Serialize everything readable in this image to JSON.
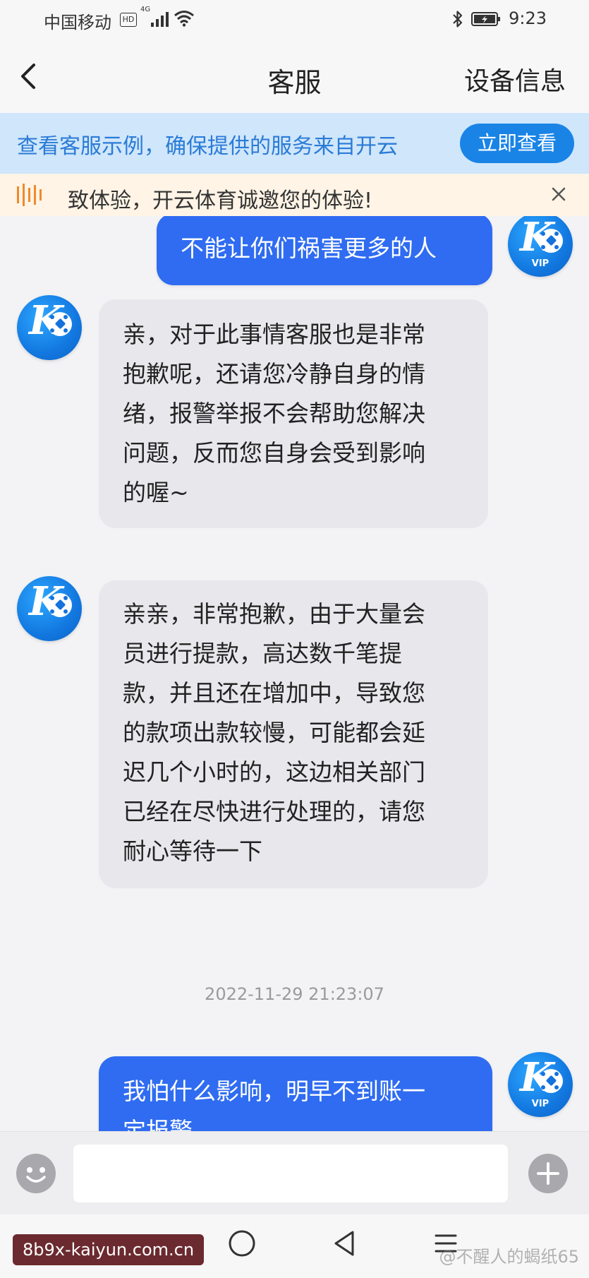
{
  "status_bar": {
    "carrier": "中国移动",
    "hd": "HD",
    "network": "4G",
    "time": "9:23"
  },
  "header": {
    "title": "客服",
    "device_info": "设备信息"
  },
  "notice": {
    "text": "查看客服示例，确保提供的服务来自开云",
    "button": "立即查看"
  },
  "marquee": {
    "text": "致体验，开云体育诚邀您的体验!"
  },
  "avatar": {
    "letter": "K",
    "vip": "VIP"
  },
  "messages": [
    {
      "sender": "user",
      "text": "不能让你们祸害更多的人"
    },
    {
      "sender": "agent",
      "text": "亲，对于此事情客服也是非常\n抱歉呢，还请您冷静自身的情\n绪，报警举报不会帮助您解决\n问题，反而您自身会受到影响\n的喔~"
    },
    {
      "sender": "agent",
      "text": "亲亲，非常抱歉，由于大量会\n员进行提款，高达数千笔提\n款，并且还在增加中，导致您\n的款项出款较慢，可能都会延\n迟几个小时的，这边相关部门\n已经在尽快进行处理的，请您\n耐心等待一下"
    },
    {
      "sender": "timestamp",
      "text": "2022-11-29 21:23:07"
    },
    {
      "sender": "user",
      "text": "我怕什么影响，明早不到账一\n定报警"
    }
  ],
  "input": {
    "placeholder": ""
  },
  "footer": {
    "site_label": "8b9x-kaiyun.com.cn",
    "watermark": "@不醒人的蝎纸65"
  },
  "colors": {
    "user_bubble": "#2f6cf1",
    "agent_bubble": "#e8e8ec",
    "accent": "#1a84e6",
    "notice_bg": "#cfe6fb"
  }
}
